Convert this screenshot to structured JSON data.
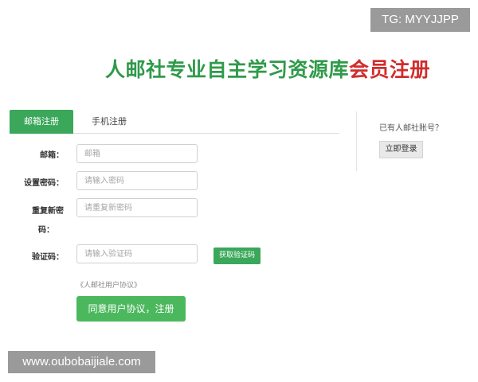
{
  "overlay": {
    "tg_text": "TG: MYYJJPP",
    "watermark_url": "www.oubobaijiale.com"
  },
  "header": {
    "title_main": "人邮社专业自主学习资源库",
    "title_accent": "会员注册"
  },
  "tabs": [
    {
      "label": "邮箱注册",
      "active": true
    },
    {
      "label": "手机注册",
      "active": false
    }
  ],
  "form": {
    "email": {
      "label": "邮箱：",
      "placeholder": "邮箱",
      "value": ""
    },
    "password": {
      "label": "设置密码：",
      "placeholder": "请输入密码",
      "value": ""
    },
    "confirm": {
      "label_line1": "重复新密",
      "label_line2": "码：",
      "placeholder": "请重复新密码",
      "value": ""
    },
    "captcha": {
      "label": "验证码：",
      "placeholder": "请输入验证码",
      "value": ""
    },
    "get_code_label": "获取验证码",
    "agreement_link": "《人邮社用户协议》",
    "submit_label": "同意用户协议，注册"
  },
  "sidebar": {
    "has_account_text": "已有人邮社账号？",
    "login_label": "立即登录"
  },
  "colors": {
    "brand_green": "#3aa75a",
    "title_green": "#2f9a4a",
    "title_red": "#d22c2c",
    "submit_green": "#4cb85e"
  }
}
